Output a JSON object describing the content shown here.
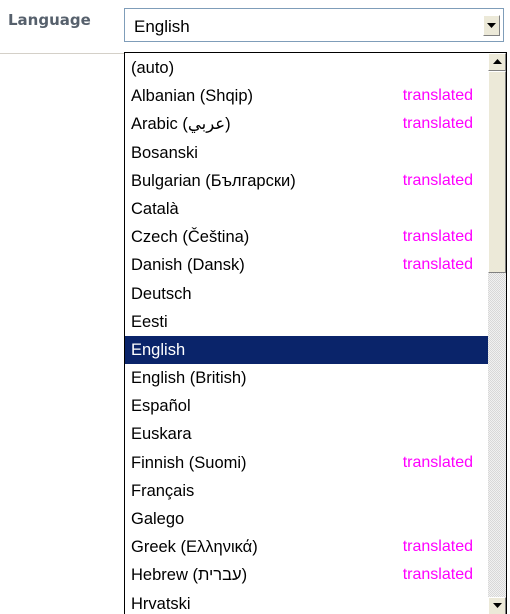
{
  "field": {
    "label": "Language",
    "selected_value": "English"
  },
  "dropdown": {
    "options": [
      {
        "label": "(auto)",
        "tag": ""
      },
      {
        "label": "Albanian (Shqip)",
        "tag": "translated"
      },
      {
        "label": "Arabic (عربي)",
        "tag": "translated"
      },
      {
        "label": "Bosanski",
        "tag": ""
      },
      {
        "label": "Bulgarian (Български)",
        "tag": "translated"
      },
      {
        "label": "Català",
        "tag": ""
      },
      {
        "label": "Czech (Čeština)",
        "tag": "translated"
      },
      {
        "label": "Danish (Dansk)",
        "tag": "translated"
      },
      {
        "label": "Deutsch",
        "tag": ""
      },
      {
        "label": "Eesti",
        "tag": ""
      },
      {
        "label": "English",
        "tag": ""
      },
      {
        "label": "English (British)",
        "tag": ""
      },
      {
        "label": "Español",
        "tag": ""
      },
      {
        "label": "Euskara",
        "tag": ""
      },
      {
        "label": "Finnish (Suomi)",
        "tag": "translated"
      },
      {
        "label": "Français",
        "tag": ""
      },
      {
        "label": "Galego",
        "tag": ""
      },
      {
        "label": "Greek (Ελληνικά)",
        "tag": "translated"
      },
      {
        "label": "Hebrew (עברית)",
        "tag": "translated"
      },
      {
        "label": "Hrvatski",
        "tag": ""
      }
    ],
    "selected_index": 10
  },
  "colors": {
    "selection_bg": "#0a246a",
    "tag_color": "#ff00ff",
    "label_color": "#56606c"
  },
  "icons": {
    "select_button": "chevron-down-icon",
    "scroll_up": "scroll-up-arrow-icon",
    "scroll_down": "scroll-down-arrow-icon"
  }
}
